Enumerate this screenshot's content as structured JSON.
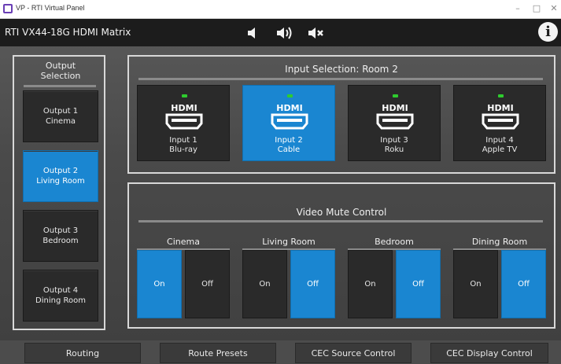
{
  "window": {
    "title": "VP - RTI Virtual Panel",
    "controls": [
      "–",
      "□",
      "✕"
    ]
  },
  "header": {
    "title": "RTI VX44-18G HDMI Matrix",
    "volume_icons": [
      "volume-down-icon",
      "volume-up-icon",
      "mute-icon"
    ],
    "info_label": "i"
  },
  "outputs": {
    "title_line1": "Output",
    "title_line2": "Selection",
    "items": [
      {
        "line1": "Output 1",
        "line2": "Cinema",
        "active": false
      },
      {
        "line1": "Output 2",
        "line2": "Living Room",
        "active": true
      },
      {
        "line1": "Output 3",
        "line2": "Bedroom",
        "active": false
      },
      {
        "line1": "Output 4",
        "line2": "Dining Room",
        "active": false
      }
    ]
  },
  "inputs": {
    "title": "Input Selection: Room 2",
    "items": [
      {
        "line1": "Input 1",
        "line2": "Blu-ray",
        "active": false
      },
      {
        "line1": "Input 2",
        "line2": "Cable",
        "active": true
      },
      {
        "line1": "Input 3",
        "line2": "Roku",
        "active": false
      },
      {
        "line1": "Input 4",
        "line2": "Apple TV",
        "active": false
      }
    ],
    "logo_text": "HDMI"
  },
  "video_mute": {
    "title": "Video Mute Control",
    "zones": [
      {
        "name": "Cinema",
        "on_label": "On",
        "off_label": "Off",
        "state": "on"
      },
      {
        "name": "Living Room",
        "on_label": "On",
        "off_label": "Off",
        "state": "off"
      },
      {
        "name": "Bedroom",
        "on_label": "On",
        "off_label": "Off",
        "state": "off"
      },
      {
        "name": "Dining Room",
        "on_label": "On",
        "off_label": "Off",
        "state": "off"
      }
    ]
  },
  "tabs": [
    "Routing",
    "Route Presets",
    "CEC Source Control",
    "CEC Display Control"
  ],
  "colors": {
    "accent": "#1a86d1",
    "button": "#2a2a2a",
    "header": "#1c1c1c",
    "led": "#2ecc2e"
  }
}
